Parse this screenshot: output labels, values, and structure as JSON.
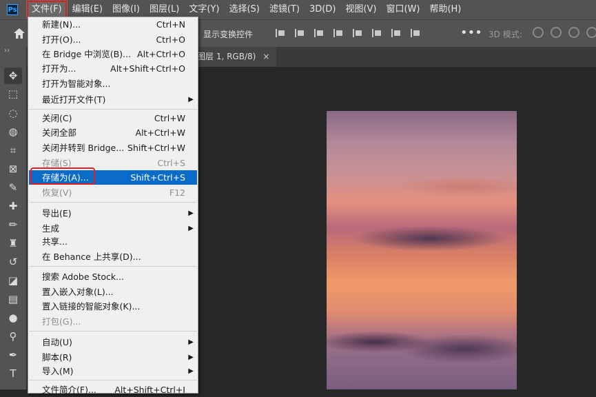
{
  "menubar": {
    "logo": "Ps",
    "items": [
      "文件(F)",
      "编辑(E)",
      "图像(I)",
      "图层(L)",
      "文字(Y)",
      "选择(S)",
      "滤镜(T)",
      "3D(D)",
      "视图(V)",
      "窗口(W)",
      "帮助(H)"
    ]
  },
  "optbar": {
    "transform_controls": "显示变换控件",
    "more": "•••",
    "mode3d": "3D 模式:"
  },
  "tab": {
    "title": "图层 1, RGB/8)",
    "close": "×"
  },
  "toolbox": {
    "collapse": "››"
  },
  "filemenu": {
    "items": [
      {
        "label": "新建(N)...",
        "shortcut": "Ctrl+N"
      },
      {
        "label": "打开(O)...",
        "shortcut": "Ctrl+O"
      },
      {
        "label": "在 Bridge 中浏览(B)...",
        "shortcut": "Alt+Ctrl+O"
      },
      {
        "label": "打开为...",
        "shortcut": "Alt+Shift+Ctrl+O"
      },
      {
        "label": "打开为智能对象...",
        "shortcut": ""
      },
      {
        "label": "最近打开文件(T)",
        "shortcut": "",
        "submenu": true
      },
      {
        "label": "关闭(C)",
        "shortcut": "Ctrl+W"
      },
      {
        "label": "关闭全部",
        "shortcut": "Alt+Ctrl+W"
      },
      {
        "label": "关闭并转到 Bridge...",
        "shortcut": "Shift+Ctrl+W"
      },
      {
        "label": "存储(S)",
        "shortcut": "Ctrl+S",
        "disabled": true
      },
      {
        "label": "存储为(A)...",
        "shortcut": "Shift+Ctrl+S",
        "selected": true
      },
      {
        "label": "恢复(V)",
        "shortcut": "F12",
        "disabled": true
      },
      {
        "label": "导出(E)",
        "shortcut": "",
        "submenu": true
      },
      {
        "label": "生成",
        "shortcut": "",
        "submenu": true
      },
      {
        "label": "共享...",
        "shortcut": ""
      },
      {
        "label": "在 Behance 上共享(D)...",
        "shortcut": ""
      },
      {
        "label": "搜索 Adobe Stock...",
        "shortcut": ""
      },
      {
        "label": "置入嵌入对象(L)...",
        "shortcut": ""
      },
      {
        "label": "置入链接的智能对象(K)...",
        "shortcut": ""
      },
      {
        "label": "打包(G)...",
        "shortcut": "",
        "disabled": true
      },
      {
        "label": "自动(U)",
        "shortcut": "",
        "submenu": true
      },
      {
        "label": "脚本(R)",
        "shortcut": "",
        "submenu": true
      },
      {
        "label": "导入(M)",
        "shortcut": "",
        "submenu": true
      },
      {
        "label": "文件简介(F)...",
        "shortcut": "Alt+Shift+Ctrl+I"
      }
    ]
  },
  "colors": {
    "menubar": "#535353",
    "workspace": "#282828",
    "menu_bg": "#f0f0f0",
    "selected": "#0a6bc9",
    "annotation": "#e02020"
  }
}
